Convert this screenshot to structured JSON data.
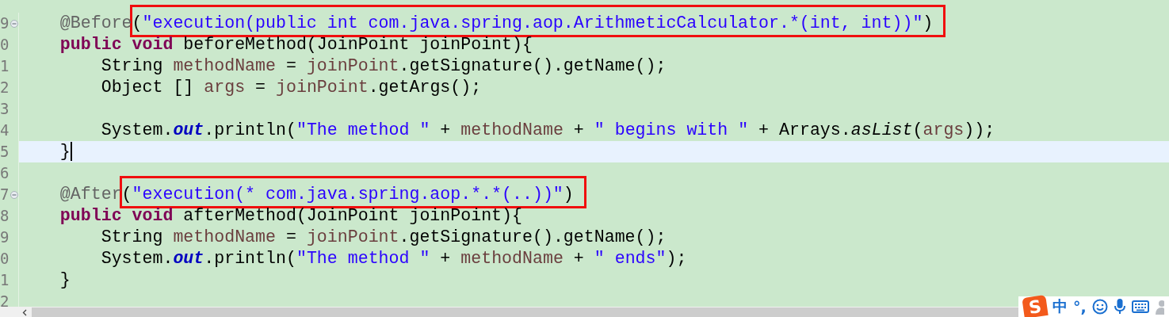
{
  "editor": {
    "lines": [
      {
        "number": "9",
        "fold": true,
        "current": false,
        "tokens": [
          {
            "kind": "ann",
            "text": "    @Before"
          },
          {
            "kind": "plain",
            "text": "(",
            "boxed": true
          },
          {
            "kind": "str",
            "text": "\"execution(public int com.java.spring.aop.ArithmeticCalculator.*(int, int))\"",
            "boxed": true
          },
          {
            "kind": "plain",
            "text": ")",
            "boxed": true
          }
        ]
      },
      {
        "number": "0",
        "fold": false,
        "current": false,
        "tokens": [
          {
            "kind": "kw",
            "text": "    public "
          },
          {
            "kind": "kw",
            "text": "void"
          },
          {
            "kind": "plain",
            "text": " beforeMethod(JoinPoint joinPoint){"
          }
        ]
      },
      {
        "number": "1",
        "fold": false,
        "current": false,
        "tokens": [
          {
            "kind": "plain",
            "text": "        String "
          },
          {
            "kind": "var",
            "text": "methodName"
          },
          {
            "kind": "plain",
            "text": " = "
          },
          {
            "kind": "var",
            "text": "joinPoint"
          },
          {
            "kind": "plain",
            "text": ".getSignature().getName();"
          }
        ]
      },
      {
        "number": "2",
        "fold": false,
        "current": false,
        "tokens": [
          {
            "kind": "plain",
            "text": "        Object [] "
          },
          {
            "kind": "var",
            "text": "args"
          },
          {
            "kind": "plain",
            "text": " = "
          },
          {
            "kind": "var",
            "text": "joinPoint"
          },
          {
            "kind": "plain",
            "text": ".getArgs();"
          }
        ]
      },
      {
        "number": "3",
        "fold": false,
        "current": false
      },
      {
        "number": "4",
        "fold": false,
        "current": false,
        "tokens": [
          {
            "kind": "plain",
            "text": "        System."
          },
          {
            "kind": "field",
            "text": "out"
          },
          {
            "kind": "plain",
            "text": ".println("
          },
          {
            "kind": "str",
            "text": "\"The method \""
          },
          {
            "kind": "plain",
            "text": " + "
          },
          {
            "kind": "var",
            "text": "methodName"
          },
          {
            "kind": "plain",
            "text": " + "
          },
          {
            "kind": "str",
            "text": "\" begins with \""
          },
          {
            "kind": "plain",
            "text": " + Arrays."
          },
          {
            "kind": "smethod",
            "text": "asList"
          },
          {
            "kind": "plain",
            "text": "("
          },
          {
            "kind": "var",
            "text": "args"
          },
          {
            "kind": "plain",
            "text": "));"
          }
        ]
      },
      {
        "number": "5",
        "fold": false,
        "current": true,
        "tokens": [
          {
            "kind": "plain",
            "text": "    }"
          }
        ]
      },
      {
        "number": "6",
        "fold": false,
        "current": false
      },
      {
        "number": "7",
        "fold": true,
        "current": false,
        "tokens": [
          {
            "kind": "ann",
            "text": "    @After"
          },
          {
            "kind": "plain",
            "text": "(",
            "boxed": true
          },
          {
            "kind": "str",
            "text": "\"execution(* com.java.spring.aop.*.*(..))\"",
            "boxed": true
          },
          {
            "kind": "plain",
            "text": ")",
            "boxed": true
          }
        ]
      },
      {
        "number": "8",
        "fold": false,
        "current": false,
        "tokens": [
          {
            "kind": "kw",
            "text": "    public "
          },
          {
            "kind": "kw",
            "text": "void"
          },
          {
            "kind": "plain",
            "text": " afterMethod(JoinPoint joinPoint){"
          }
        ]
      },
      {
        "number": "9",
        "fold": false,
        "current": false,
        "tokens": [
          {
            "kind": "plain",
            "text": "        String "
          },
          {
            "kind": "var",
            "text": "methodName"
          },
          {
            "kind": "plain",
            "text": " = "
          },
          {
            "kind": "var",
            "text": "joinPoint"
          },
          {
            "kind": "plain",
            "text": ".getSignature().getName();"
          }
        ]
      },
      {
        "number": "0",
        "fold": false,
        "current": false,
        "tokens": [
          {
            "kind": "plain",
            "text": "        System."
          },
          {
            "kind": "field",
            "text": "out"
          },
          {
            "kind": "plain",
            "text": ".println("
          },
          {
            "kind": "str",
            "text": "\"The method \""
          },
          {
            "kind": "plain",
            "text": " + "
          },
          {
            "kind": "var",
            "text": "methodName"
          },
          {
            "kind": "plain",
            "text": " + "
          },
          {
            "kind": "str",
            "text": "\" ends\""
          },
          {
            "kind": "plain",
            "text": ");"
          }
        ]
      },
      {
        "number": "1",
        "fold": false,
        "current": false,
        "tokens": [
          {
            "kind": "plain",
            "text": "    }"
          }
        ]
      },
      {
        "number": "2",
        "fold": false,
        "current": false
      }
    ]
  },
  "ime_bar": {
    "logo": "S",
    "mode": "中",
    "punctuation": "°,"
  }
}
